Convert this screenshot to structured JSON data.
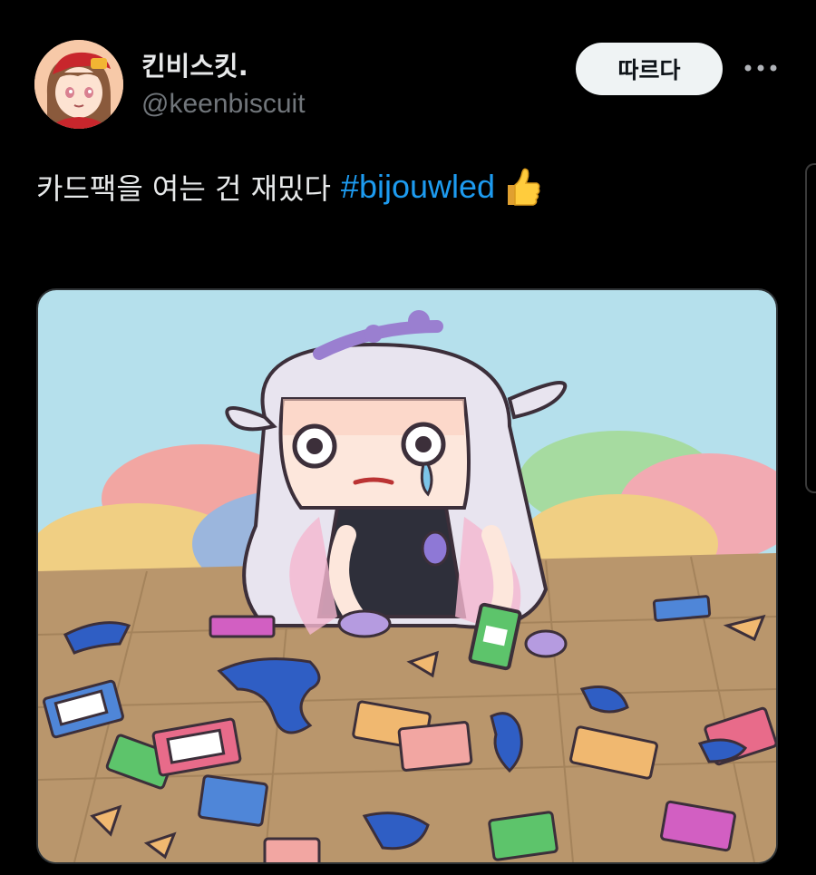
{
  "tweet": {
    "author": {
      "display_name": "킨비스킷.",
      "handle": "@keenbiscuit",
      "avatar_icon": "avatar-girl-red-cap"
    },
    "follow_label": "따르다",
    "more_icon": "ellipsis-icon",
    "text": "카드팩을 여는 건 재밌다",
    "hashtag": "#bijouwled",
    "emoji": "thumbs-up",
    "media": {
      "icon": "illustration-crying-girl-with-card-packs"
    }
  },
  "colors": {
    "background": "#000000",
    "text": "#e7e9ea",
    "secondary": "#71767b",
    "link": "#1d9bf0",
    "follow_bg": "#eff3f4"
  }
}
